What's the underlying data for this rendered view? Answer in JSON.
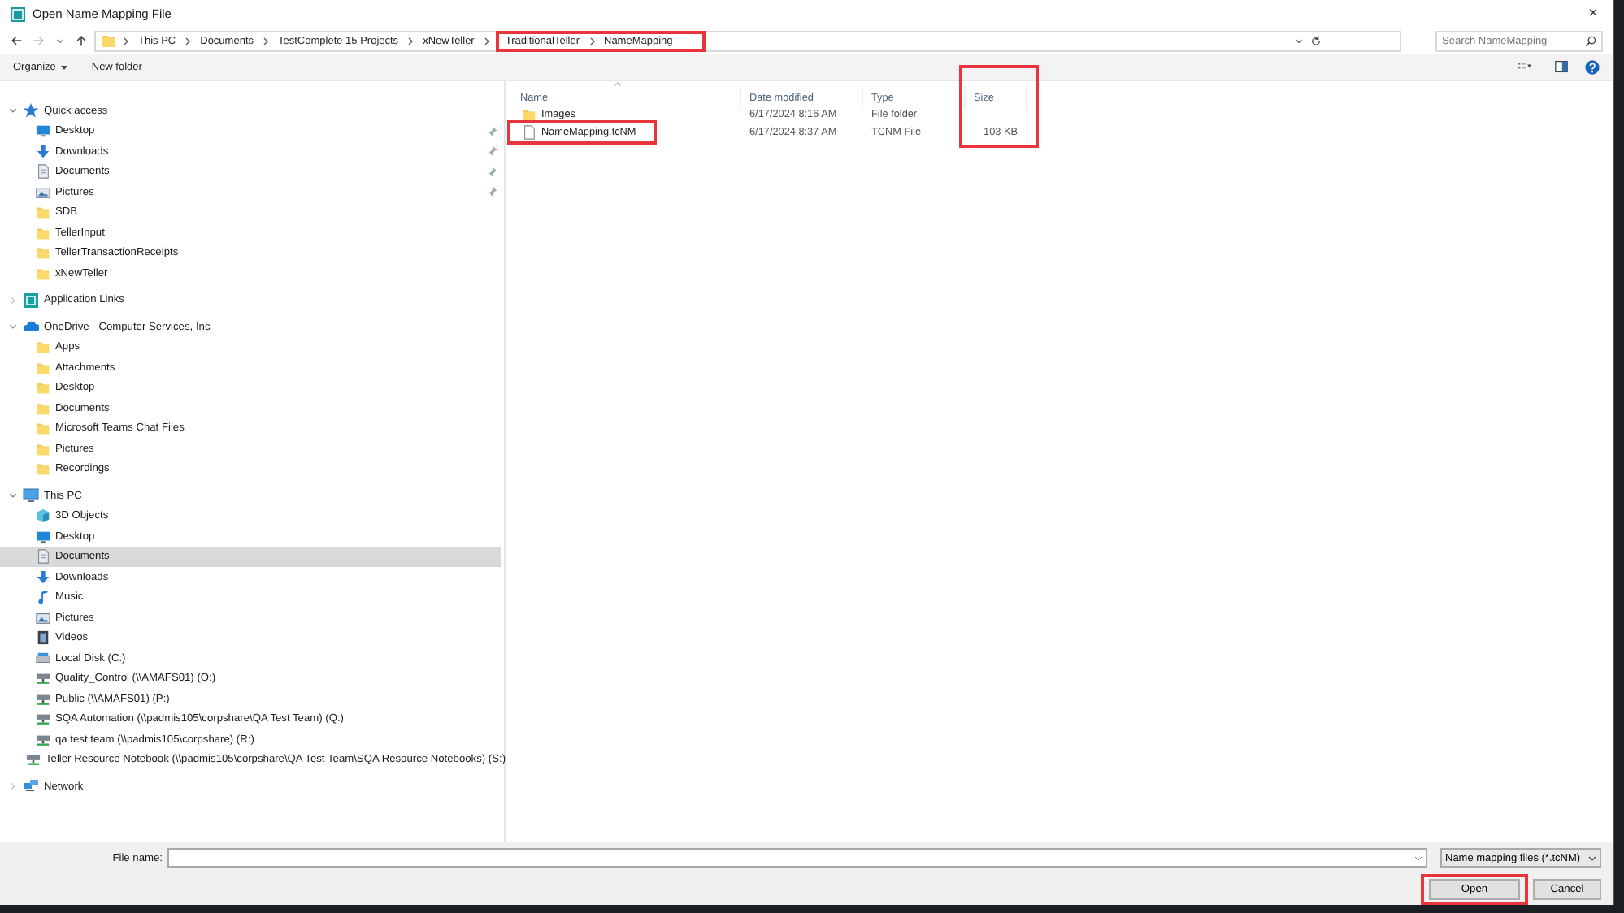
{
  "window": {
    "title": "Open Name Mapping File",
    "close_glyph": "×"
  },
  "address": {
    "crumbs": [
      {
        "label": "This PC",
        "highlighted": false
      },
      {
        "label": "Documents",
        "highlighted": false
      },
      {
        "label": "TestComplete 15 Projects",
        "highlighted": false
      },
      {
        "label": "xNewTeller",
        "highlighted": false
      },
      {
        "label": "TraditionalTeller",
        "highlighted": true
      },
      {
        "label": "NameMapping",
        "highlighted": true
      }
    ]
  },
  "search": {
    "placeholder": "Search NameMapping"
  },
  "toolbar": {
    "organize": "Organize",
    "new_folder": "New folder"
  },
  "sidebar": {
    "items": [
      {
        "label": "Quick access",
        "kind": "star",
        "expanded": true,
        "selected": false,
        "children": [
          {
            "label": "Desktop",
            "kind": "desktop",
            "pinned": true,
            "selected": false
          },
          {
            "label": "Downloads",
            "kind": "downloads",
            "pinned": true,
            "selected": false
          },
          {
            "label": "Documents",
            "kind": "documents",
            "pinned": true,
            "selected": false
          },
          {
            "label": "Pictures",
            "kind": "pictures",
            "pinned": true,
            "selected": false
          },
          {
            "label": "SDB",
            "kind": "folder",
            "pinned": false,
            "selected": false
          },
          {
            "label": "TellerInput",
            "kind": "folder",
            "pinned": false,
            "selected": false
          },
          {
            "label": "TellerTransactionReceipts",
            "kind": "folder",
            "pinned": false,
            "selected": false
          },
          {
            "label": "xNewTeller",
            "kind": "folder",
            "pinned": false,
            "selected": false
          }
        ]
      },
      {
        "label": "Application Links",
        "kind": "apps",
        "expanded": false,
        "selected": false
      },
      {
        "label": "OneDrive - Computer Services, Inc",
        "kind": "cloud",
        "expanded": true,
        "selected": false,
        "children": [
          {
            "label": "Apps",
            "kind": "folder",
            "selected": false
          },
          {
            "label": "Attachments",
            "kind": "folder",
            "selected": false
          },
          {
            "label": "Desktop",
            "kind": "folder",
            "selected": false
          },
          {
            "label": "Documents",
            "kind": "folder",
            "selected": false
          },
          {
            "label": "Microsoft Teams Chat Files",
            "kind": "folder",
            "selected": false
          },
          {
            "label": "Pictures",
            "kind": "folder",
            "selected": false
          },
          {
            "label": "Recordings",
            "kind": "folder",
            "selected": false
          }
        ]
      },
      {
        "label": "This PC",
        "kind": "pc",
        "expanded": true,
        "selected": false,
        "children": [
          {
            "label": "3D Objects",
            "kind": "cube",
            "selected": false
          },
          {
            "label": "Desktop",
            "kind": "desktop",
            "selected": false
          },
          {
            "label": "Documents",
            "kind": "documents",
            "selected": true
          },
          {
            "label": "Downloads",
            "kind": "downloads",
            "selected": false
          },
          {
            "label": "Music",
            "kind": "music",
            "selected": false
          },
          {
            "label": "Pictures",
            "kind": "pictures",
            "selected": false
          },
          {
            "label": "Videos",
            "kind": "videos",
            "selected": false
          },
          {
            "label": "Local Disk (C:)",
            "kind": "disk",
            "selected": false
          },
          {
            "label": "Quality_Control (\\\\AMAFS01) (O:)",
            "kind": "netdrive",
            "selected": false
          },
          {
            "label": "Public (\\\\AMAFS01) (P:)",
            "kind": "netdrive",
            "selected": false
          },
          {
            "label": "SQA Automation (\\\\padmis105\\corpshare\\QA Test Team) (Q:)",
            "kind": "netdrive",
            "selected": false
          },
          {
            "label": "qa test team (\\\\padmis105\\corpshare) (R:)",
            "kind": "netdrive",
            "selected": false
          },
          {
            "label": "Teller Resource Notebook (\\\\padmis105\\corpshare\\QA Test Team\\SQA Resource Notebooks) (S:)",
            "kind": "netdrive",
            "selected": false
          }
        ]
      },
      {
        "label": "Network",
        "kind": "network",
        "expanded": false,
        "selected": false
      }
    ]
  },
  "file_list": {
    "columns": [
      {
        "label": "Name",
        "sorted": true,
        "highlighted": false
      },
      {
        "label": "Date modified",
        "sorted": false,
        "highlighted": false
      },
      {
        "label": "Type",
        "sorted": false,
        "highlighted": false
      },
      {
        "label": "Size",
        "sorted": false,
        "highlighted": true
      }
    ],
    "rows": [
      {
        "kind": "folder",
        "name": "Images",
        "date": "6/17/2024 8:16 AM",
        "type": "File folder",
        "highlighted": false
      },
      {
        "kind": "file",
        "name": "NameMapping.tcNM",
        "date": "6/17/2024 8:37 AM",
        "type": "TCNM File",
        "size": "103 KB",
        "highlighted": true
      }
    ]
  },
  "footer": {
    "file_name_label": "File name:",
    "file_type": "Name mapping files  (*.tcNM)",
    "buttons": [
      {
        "label": "Open",
        "highlighted": true
      },
      {
        "label": "Cancel",
        "highlighted": false
      }
    ]
  }
}
